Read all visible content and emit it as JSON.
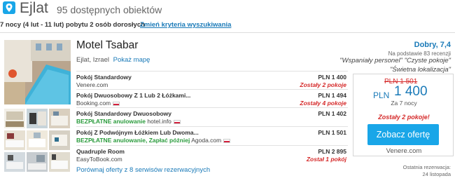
{
  "header": {
    "city": "Ejlat",
    "count": "95 dostępnych obiektów",
    "stay": "7 nocy (4 lut - 11 lut) pobytu 2 osób dorosłych",
    "change_criteria": "Zmień kryteria wyszukiwania"
  },
  "hotel": {
    "name": "Motel Tsabar",
    "location": "Ejlat, Izrael",
    "map_link": "Pokaż mapę",
    "rating": "Dobry, 7,4",
    "rating_base": "Na podstawie 83 recenzji",
    "review_1": "\"Wspaniały personel\"",
    "review_2": "\"Czyste pokoje\"",
    "review_3": "\"Świetna lokalizacja\""
  },
  "offers": [
    {
      "title": "Pokój Standardowy",
      "vendor": "Venere.com",
      "free_cancel": "",
      "pay_later": "",
      "price": "PLN 1 400",
      "rooms_left": "Zostały 2 pokoje",
      "flag": false
    },
    {
      "title": "Pokój Dwuosobowy Z 1 Lub 2 Łóżkami...",
      "vendor": "Booking.com",
      "free_cancel": "",
      "pay_later": "",
      "price": "PLN 1 494",
      "rooms_left": "Zostały 4 pokoje",
      "flag": true
    },
    {
      "title": "Pokój Standardowy Dwuosobowy",
      "vendor": "hotel.info",
      "free_cancel": "BEZPŁATNE anulowanie",
      "pay_later": "",
      "price": "PLN 1 402",
      "rooms_left": "",
      "flag": true
    },
    {
      "title": "Pokój Z Podwójnym Łóżkiem Lub Dwoma...",
      "vendor": "Agoda.com",
      "free_cancel": "BEZPŁATNE anulowanie, Zapłać później",
      "pay_later": "",
      "price": "PLN 1 501",
      "rooms_left": "",
      "flag": true
    },
    {
      "title": "Quadruple Room",
      "vendor": "EasyToBook.com",
      "free_cancel": "",
      "pay_later": "",
      "price": "PLN 2 895",
      "rooms_left": "Został 1 pokój",
      "flag": false
    }
  ],
  "compare_link": "Porównaj oferty z 8 serwisów rezerwacyjnych",
  "deal": {
    "old_price": "PLN 1 501",
    "currency": "PLN",
    "new_price": "1 400",
    "nights": "Za 7 nocy",
    "rooms_left": "Zostały 2 pokoje!",
    "cta": "Zobacz ofertę",
    "vendor": "Venere.com"
  },
  "last_reservation": {
    "label": "Ostatnia rezerwacja:",
    "date": "24 listopada"
  },
  "colors": {
    "accent": "#1a7ab8",
    "cta": "#19a6e8",
    "alert": "#d52a2a",
    "free": "#2a9b3c"
  }
}
